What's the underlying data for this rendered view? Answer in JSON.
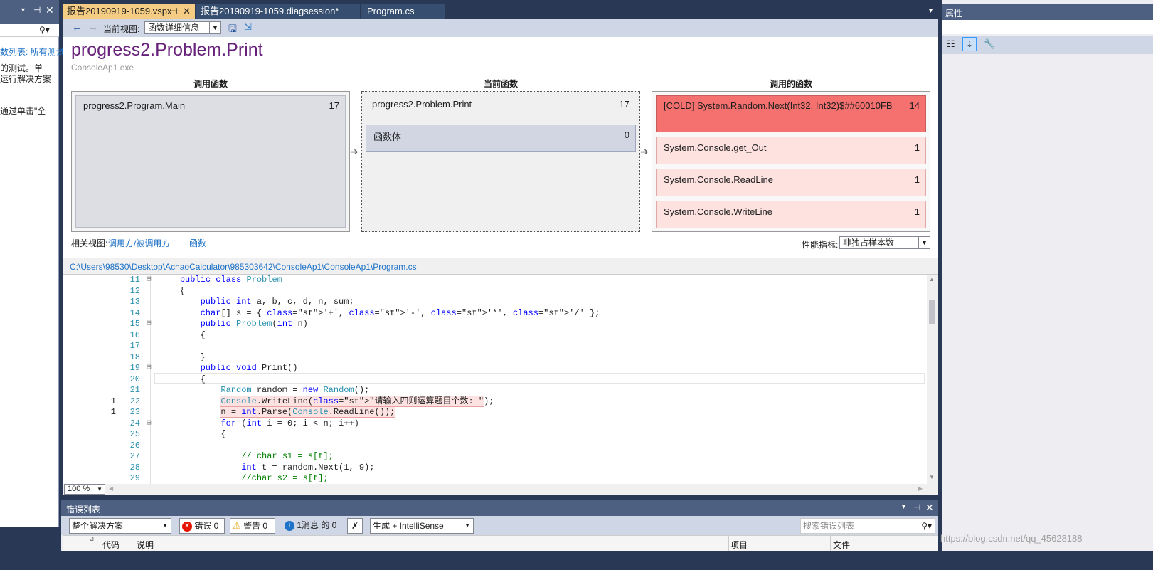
{
  "left_panel": {
    "partial_lines": [
      "数列表: 所有测试",
      "的测试。单",
      "运行解决方案",
      "通过单击\"全"
    ]
  },
  "tabs": [
    {
      "label": "报告20190919-1059.vspx",
      "active": true
    },
    {
      "label": "报告20190919-1059.diagsession*",
      "active": false
    },
    {
      "label": "Program.cs",
      "active": false
    }
  ],
  "toolbar": {
    "current_view_label": "当前视图:",
    "current_view_value": "函数详细信息"
  },
  "header": {
    "function_title": "progress2.Problem.Print",
    "module": "ConsoleAp1.exe"
  },
  "callers": {
    "heading": "调用函数",
    "items": [
      {
        "name": "progress2.Program.Main",
        "value": "17"
      }
    ]
  },
  "current": {
    "heading": "当前函数",
    "name": "progress2.Problem.Print",
    "value": "17",
    "body_label": "函数体",
    "body_value": "0"
  },
  "callees": {
    "heading": "调用的函数",
    "items": [
      {
        "name": "[COLD] System.Random.Next(Int32, Int32)$##60010FB",
        "value": "14"
      },
      {
        "name": "System.Console.get_Out",
        "value": "1"
      },
      {
        "name": "System.Console.ReadLine",
        "value": "1"
      },
      {
        "name": "System.Console.WriteLine",
        "value": "1"
      }
    ]
  },
  "related": {
    "label": "相关视图:",
    "link1": "调用方/被调用方",
    "link2": "函数"
  },
  "metric": {
    "label": "性能指标:",
    "value": "非独占样本数"
  },
  "file_path": "C:\\Users\\98530\\Desktop\\AchaoCalculator\\985303642\\ConsoleAp1\\ConsoleAp1\\Program.cs",
  "code": {
    "lines": [
      {
        "n": "11",
        "hits": "",
        "collapse": "⊟",
        "text": "    public class Problem"
      },
      {
        "n": "12",
        "hits": "",
        "collapse": "",
        "text": "    {"
      },
      {
        "n": "13",
        "hits": "",
        "collapse": "",
        "text": "        public int a, b, c, d, n, sum;"
      },
      {
        "n": "14",
        "hits": "",
        "collapse": "",
        "text": "        char[] s = { '+', '-', '*', '/' };"
      },
      {
        "n": "15",
        "hits": "",
        "collapse": "⊟",
        "text": "        public Problem(int n)"
      },
      {
        "n": "16",
        "hits": "",
        "collapse": "",
        "text": "        {"
      },
      {
        "n": "17",
        "hits": "",
        "collapse": "",
        "text": ""
      },
      {
        "n": "18",
        "hits": "",
        "collapse": "",
        "text": "        }"
      },
      {
        "n": "19",
        "hits": "",
        "collapse": "⊟",
        "text": "        public void Print()"
      },
      {
        "n": "20",
        "hits": "",
        "collapse": "",
        "text": "        {"
      },
      {
        "n": "21",
        "hits": "",
        "collapse": "",
        "text": "            Random random = new Random();"
      },
      {
        "n": "22",
        "hits": "1",
        "collapse": "",
        "text": "            Console.WriteLine(\"请输入四则运算题目个数: \");"
      },
      {
        "n": "23",
        "hits": "1",
        "collapse": "",
        "text": "            n = int.Parse(Console.ReadLine());"
      },
      {
        "n": "24",
        "hits": "",
        "collapse": "⊟",
        "text": "            for (int i = 0; i < n; i++)"
      },
      {
        "n": "25",
        "hits": "",
        "collapse": "",
        "text": "            {"
      },
      {
        "n": "26",
        "hits": "",
        "collapse": "",
        "text": ""
      },
      {
        "n": "27",
        "hits": "",
        "collapse": "",
        "text": "                // char s1 = s[t];"
      },
      {
        "n": "28",
        "hits": "",
        "collapse": "",
        "text": "                int t = random.Next(1, 9);"
      },
      {
        "n": "29",
        "hits": "",
        "collapse": "",
        "text": "                //char s2 = s[t];"
      }
    ]
  },
  "zoom": "100 %",
  "error_list": {
    "title": "错误列表",
    "scope": "整个解决方案",
    "errors": "错误 0",
    "warnings": "警告 0",
    "messages": "1消息 的 0",
    "build": "生成 + IntelliSense",
    "search_placeholder": "搜索错误列表",
    "columns": {
      "code": "代码",
      "desc": "说明",
      "project": "项目",
      "file": "文件"
    }
  },
  "properties": {
    "title": "属性"
  },
  "watermark": "https://blog.csdn.net/qq_45628188"
}
